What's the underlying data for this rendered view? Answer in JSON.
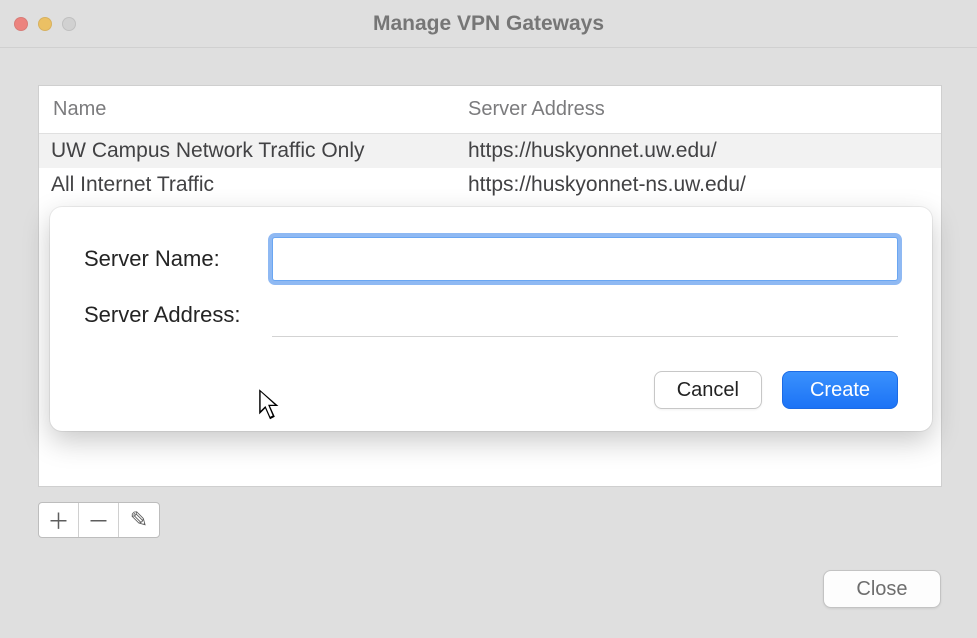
{
  "window": {
    "title": "Manage VPN Gateways"
  },
  "table": {
    "headers": {
      "name": "Name",
      "address": "Server Address"
    },
    "rows": [
      {
        "name": "UW Campus Network Traffic Only",
        "address": "https://huskyonnet.uw.edu/"
      },
      {
        "name": "All Internet Traffic",
        "address": "https://huskyonnet-ns.uw.edu/"
      }
    ]
  },
  "toolbar": {
    "add_icon": "＋",
    "remove_icon": "－",
    "edit_icon": "✎"
  },
  "footer": {
    "close_label": "Close"
  },
  "dialog": {
    "server_name_label": "Server Name:",
    "server_address_label": "Server Address:",
    "server_name_value": "",
    "server_address_value": "",
    "cancel_label": "Cancel",
    "create_label": "Create"
  }
}
